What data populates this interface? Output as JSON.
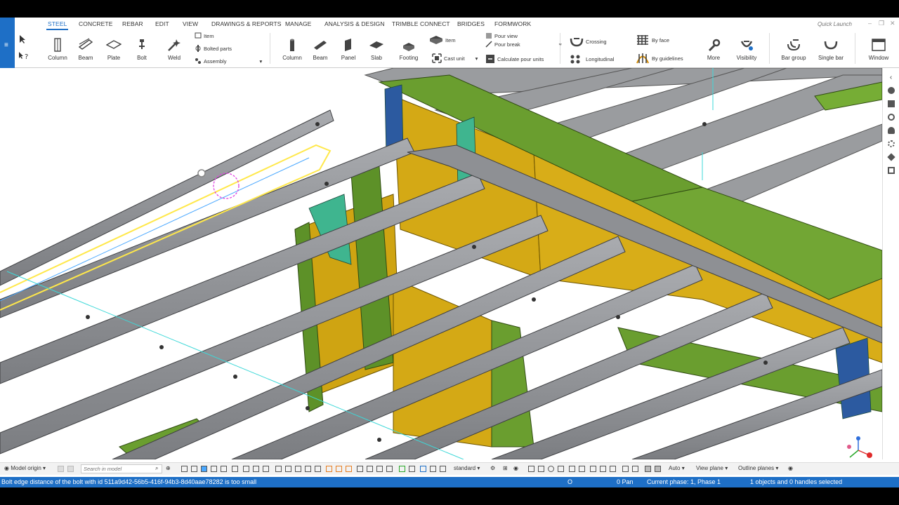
{
  "menu": {
    "tabs": [
      "STEEL",
      "CONCRETE",
      "REBAR",
      "EDIT",
      "VIEW",
      "DRAWINGS & REPORTS",
      "MANAGE",
      "ANALYSIS & DESIGN",
      "TRIMBLE CONNECT",
      "BRIDGES",
      "FORMWORK"
    ],
    "active": "STEEL",
    "quick_launch_placeholder": "Quick Launch"
  },
  "ribbon": {
    "steel": {
      "column": "Column",
      "beam": "Beam",
      "plate": "Plate",
      "bolt": "Bolt",
      "weld": "Weld",
      "item": "Item",
      "bolted_parts": "Bolted parts",
      "assembly": "Assembly"
    },
    "concrete": {
      "column": "Column",
      "beam": "Beam",
      "panel": "Panel",
      "slab": "Slab",
      "footing": "Footing",
      "item": "Item",
      "cast_unit": "Cast unit",
      "pour_view": "Pour view",
      "pour_break": "Pour break",
      "calculate_pour_units": "Calculate pour units"
    },
    "rebar": {
      "crossing": "Crossing",
      "longitudinal": "Longitudinal",
      "by_face": "By face",
      "by_guidelines": "By guidelines",
      "more": "More",
      "visibility": "Visibility",
      "bar_group": "Bar group",
      "single_bar": "Single bar",
      "window": "Window"
    }
  },
  "bottom_toolbar": {
    "model_origin": "Model origin",
    "search_placeholder": "Search in model",
    "view_mode": "standard",
    "auto": "Auto",
    "view_plane": "View plane",
    "outline_planes": "Outline planes"
  },
  "status_bar": {
    "message": "Bolt edge distance of the bolt with id 511a9d42-56b5-416f-94b3-8d40aae78282 is too small",
    "snap": "O",
    "pan": "0 Pan",
    "phase": "Current phase: 1, Phase 1",
    "selection": "1 objects and 0 handles selected"
  },
  "colors": {
    "accent": "#1e6fc6",
    "steel": "#8a8c90",
    "yellow_plate": "#d4a915",
    "green_plate": "#6a9e2f",
    "teal_plate": "#3fb58f",
    "highlight": "#ffe84a"
  }
}
